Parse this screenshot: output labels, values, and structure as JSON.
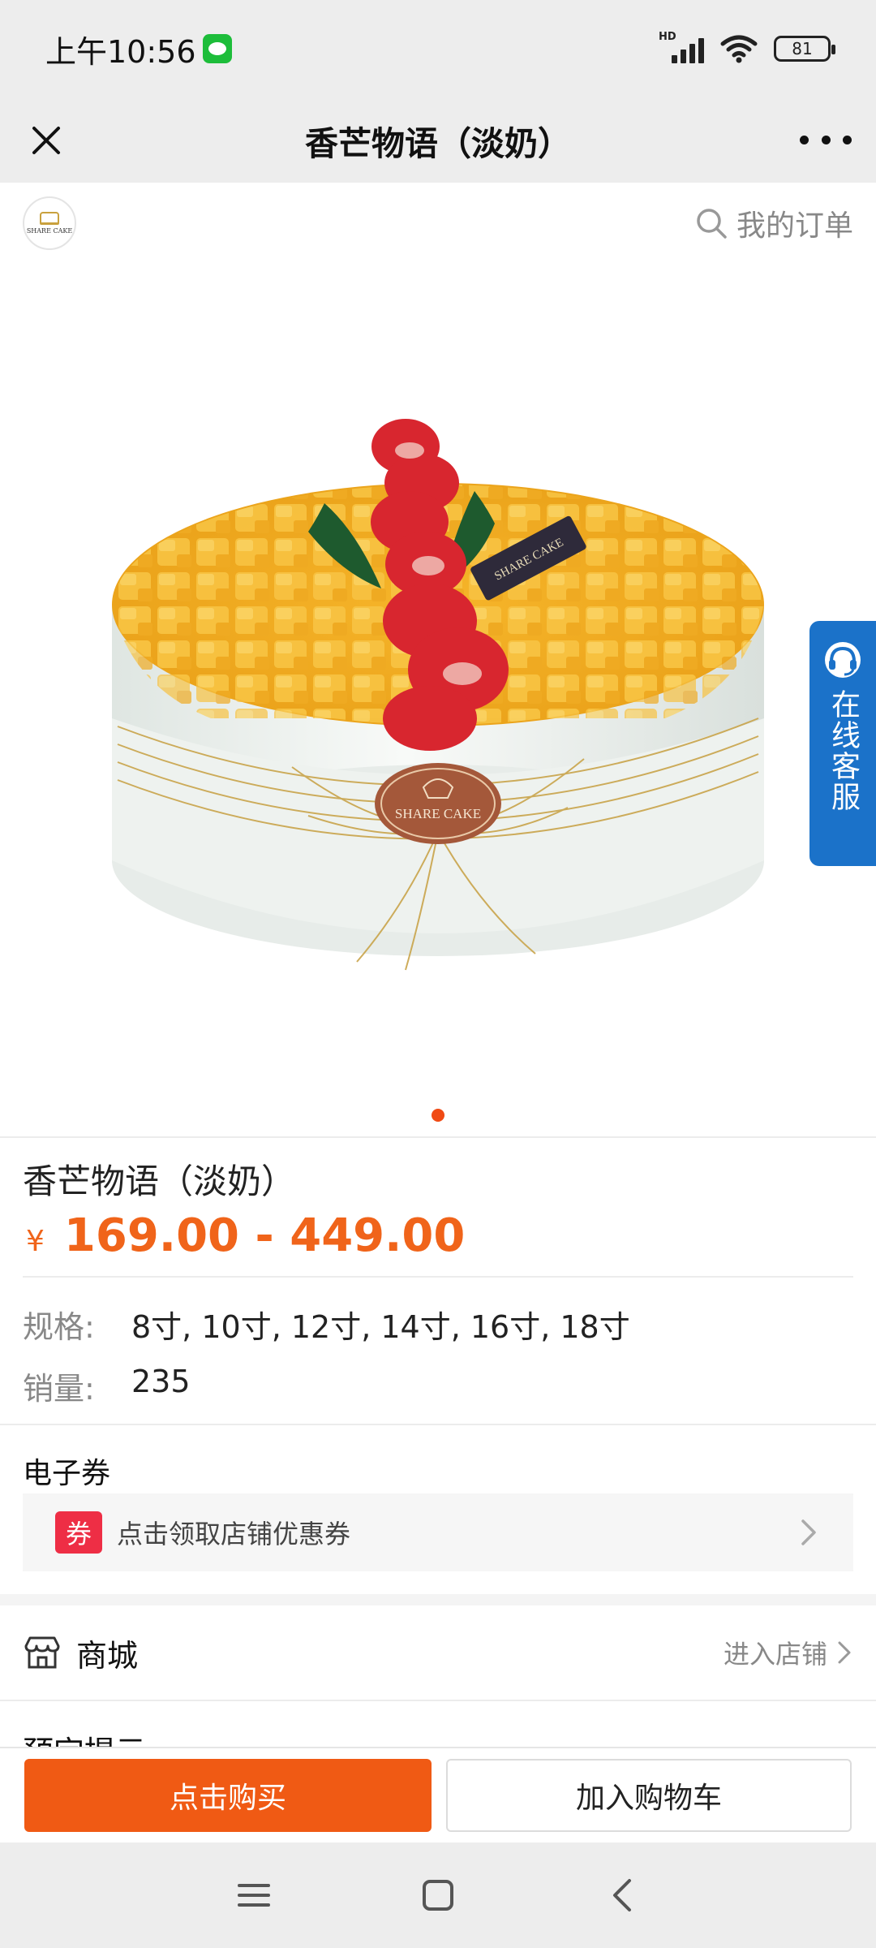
{
  "status_bar": {
    "time": "上午10:56",
    "hd_label": "HD",
    "battery": "81"
  },
  "title_bar": {
    "title": "香芒物语（淡奶）"
  },
  "store": {
    "logo_text": "SHARE CAKE",
    "my_orders": "我的订单"
  },
  "product_image": {
    "cake_plaque_text": "SHARE CAKE",
    "carousel_index": 1,
    "carousel_total": 1
  },
  "service": {
    "label": "在线客服"
  },
  "product": {
    "name": "香芒物语（淡奶）",
    "currency": "¥",
    "price_range": "169.00 - 449.00",
    "spec_label": "规格:",
    "spec_value": "8寸, 10寸, 12寸, 14寸, 16寸, 18寸",
    "sales_label": "销量:",
    "sales_value": "235"
  },
  "coupon": {
    "section_title": "电子券",
    "badge": "券",
    "text": "点击领取店铺优惠券"
  },
  "mall": {
    "label": "商城",
    "enter_link": "进入店铺"
  },
  "notice": {
    "title": "预定提示"
  },
  "actions": {
    "buy": "点击购买",
    "add_to_cart": "加入购物车"
  },
  "colors": {
    "accent": "#f05a14",
    "price": "#f0641a",
    "coupon_badge": "#ee2e45",
    "service_blue": "#1b72c9"
  }
}
